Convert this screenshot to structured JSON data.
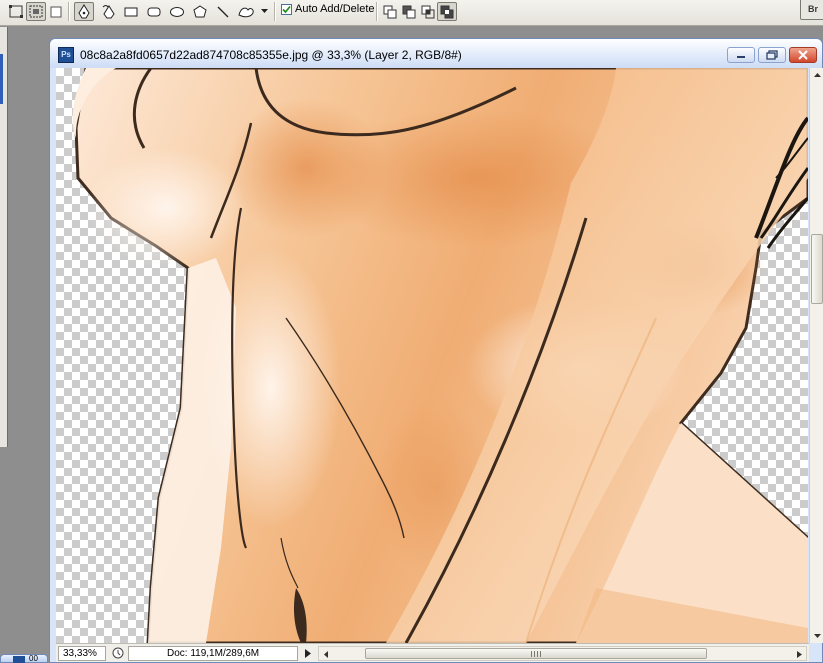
{
  "options_bar": {
    "tools": [
      {
        "name": "shape-layers-icon"
      },
      {
        "name": "paths-icon"
      },
      {
        "name": "fill-pixels-icon"
      },
      {
        "name": "pen-tool-icon"
      },
      {
        "name": "freeform-pen-icon"
      },
      {
        "name": "rectangle-tool-icon"
      },
      {
        "name": "rounded-rectangle-tool-icon"
      },
      {
        "name": "ellipse-tool-icon"
      },
      {
        "name": "polygon-tool-icon"
      },
      {
        "name": "line-tool-icon"
      },
      {
        "name": "custom-shape-tool-icon"
      }
    ],
    "auto_add_delete": {
      "label": "Auto Add/Delete",
      "checked": true
    },
    "path_modes": [
      "add-to-path-icon",
      "subtract-from-path-icon",
      "intersect-path-icon",
      "exclude-overlap-icon"
    ],
    "bridge_label": "Br"
  },
  "document": {
    "title": "08c8a2a8fd0657d22ad874708c85355e.jpg @ 33,3% (Layer 2, RGB/8#)",
    "app_icon_label": "Ps",
    "buttons": {
      "minimize": "minimize",
      "restore": "restore",
      "close": "close"
    }
  },
  "status_bar": {
    "zoom": "33,33%",
    "doc_info": "Doc: 119,1M/289,6M"
  },
  "secondary_doc": {
    "label": "00"
  },
  "colors": {
    "skin_light": "#fde8d6",
    "skin_mid": "#f6c08e",
    "skin_shadow": "#e89a5c",
    "outline": "#4a3526",
    "titlebar": "#cddcf5",
    "close_button": "#d1462b"
  }
}
